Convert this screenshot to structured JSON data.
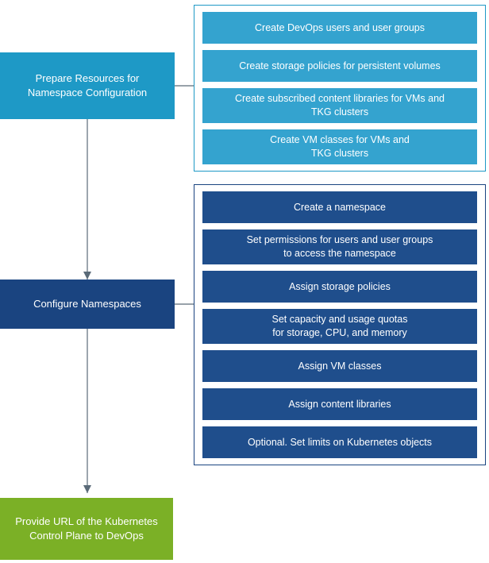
{
  "step1": {
    "label": "Prepare Resources for\nNamespace Configuration",
    "items": [
      "Create DevOps users and user groups",
      "Create storage policies for persistent volumes",
      "Create subscribed content libraries for VMs and\nTKG clusters",
      "Create VM classes for VMs and\nTKG clusters"
    ]
  },
  "step2": {
    "label": "Configure Namespaces",
    "items": [
      "Create a namespace",
      "Set permissions for users and user groups\n to access the namespace",
      "Assign storage policies",
      "Set capacity and usage quotas\n for storage, CPU, and  memory",
      "Assign VM classes",
      "Assign content libraries",
      "Optional. Set limits on Kubernetes objects"
    ]
  },
  "step3": {
    "label": "Provide URL of the Kubernetes Control Plane to DevOps"
  },
  "colors": {
    "step1": "#1e99c6",
    "step2": "#1a4480",
    "step3": "#7bb026",
    "sub1": "#34a3cf",
    "sub2": "#1f4e8c",
    "connector": "#5a6a78"
  }
}
